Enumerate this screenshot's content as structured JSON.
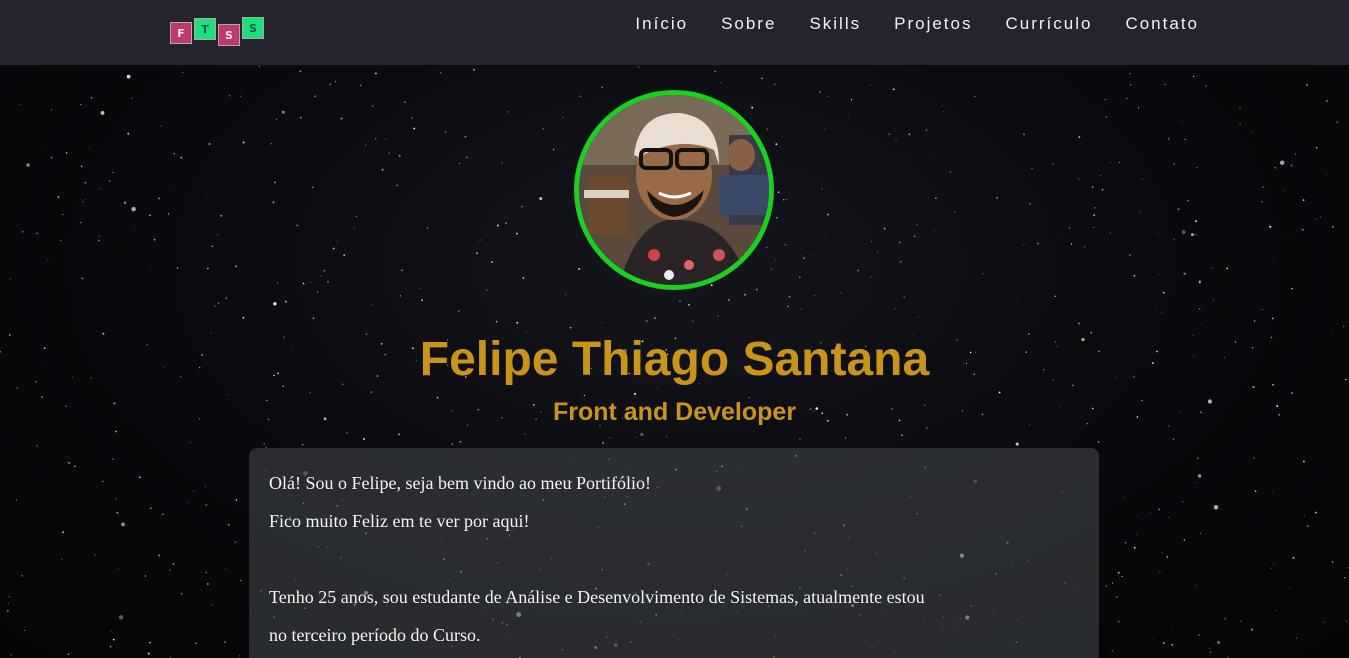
{
  "logo": {
    "letters": [
      "F",
      "T",
      "S",
      "S"
    ]
  },
  "nav": {
    "items": [
      "Início",
      "Sobre",
      "Skills",
      "Projetos",
      "Currículo",
      "Contato"
    ]
  },
  "hero": {
    "name": "Felipe Thiago Santana",
    "role": "Front and Developer"
  },
  "about": {
    "line1": "Olá! Sou o Felipe, seja bem vindo ao meu Portifólio!",
    "line2": "Fico muito Feliz em te ver por aqui!",
    "line3": "Tenho 25 anos, sou estudante de Análise e Desenvolvimento de Sistemas, atualmente estou",
    "line4": "no terceiro período do Curso."
  },
  "colors": {
    "accent": "#c99419",
    "avatar_border": "#19d11f",
    "navbar": "#23242d",
    "logo_pink": "#c2386e",
    "logo_green": "#1ee07a"
  }
}
